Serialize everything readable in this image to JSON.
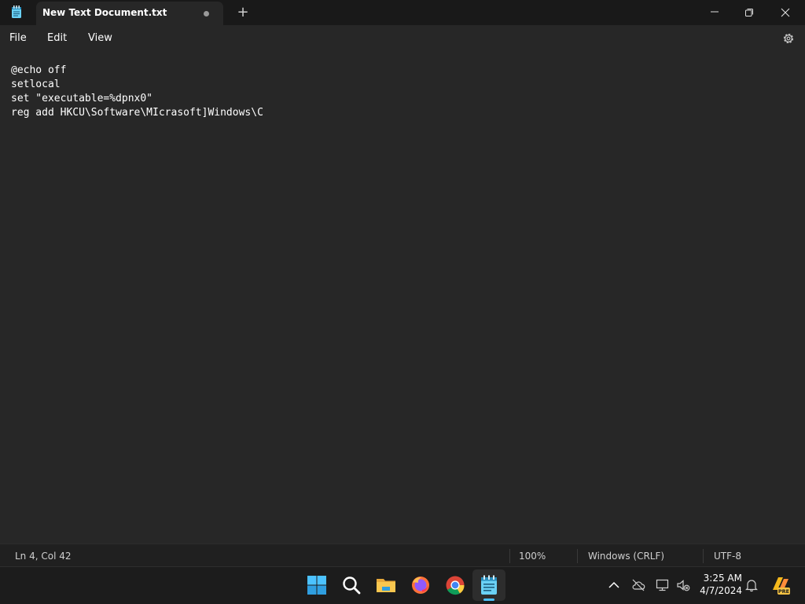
{
  "window": {
    "tab_title": "New Text Document.txt",
    "new_tab_label": "+",
    "controls": [
      "minimize-icon",
      "restore-icon",
      "close-icon"
    ]
  },
  "menu": {
    "file": "File",
    "edit": "Edit",
    "view": "View",
    "settings_icon": "gear-icon"
  },
  "editor": {
    "lines": [
      "@echo off",
      "setlocal",
      "set \"executable=%dpnx0\"",
      "reg add HKCU\\Software\\MIcrasoft]Windows\\C"
    ]
  },
  "status": {
    "position": "Ln 4, Col 42",
    "zoom": "100%",
    "line_endings": "Windows (CRLF)",
    "encoding": "UTF-8"
  },
  "taskbar": {
    "apps": [
      "start-icon",
      "search-icon",
      "file-explorer-icon",
      "firefox-icon",
      "chrome-icon",
      "notepad-icon"
    ],
    "tray": [
      "chevron-up-icon",
      "cloud-offline-icon",
      "network-icon",
      "volume-muted-icon",
      "notification-bell-icon",
      "copilot-pre-icon"
    ],
    "time": "3:25 AM",
    "date": "4/7/2024",
    "copilot_badge": "PRE"
  },
  "colors": {
    "accent": "#4cc2ff",
    "editor_bg": "#272727",
    "titlebar_bg": "#191919"
  }
}
